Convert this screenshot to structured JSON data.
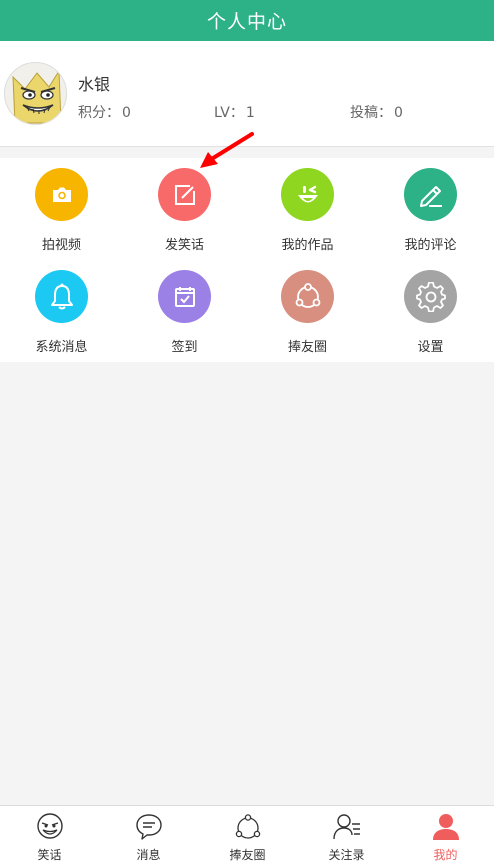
{
  "header": {
    "title": "个人中心"
  },
  "profile": {
    "name": "水银",
    "score_label": "积分：",
    "score": "0",
    "level_label": "LV：",
    "level": "1",
    "posts_label": "投稿：",
    "posts": "0"
  },
  "menu": [
    {
      "label": "拍视频",
      "color": "#f7b500",
      "icon": "camera-icon"
    },
    {
      "label": "发笑话",
      "color": "#f86a6a",
      "icon": "edit-icon"
    },
    {
      "label": "我的作品",
      "color": "#8ed61f",
      "icon": "wink-face-icon"
    },
    {
      "label": "我的评论",
      "color": "#2db186",
      "icon": "pencil-icon"
    },
    {
      "label": "系统消息",
      "color": "#1bc9f3",
      "icon": "bell-icon"
    },
    {
      "label": "签到",
      "color": "#9b80e6",
      "icon": "calendar-check-icon"
    },
    {
      "label": "捧友圈",
      "color": "#d88f7f",
      "icon": "circle-nodes-icon"
    },
    {
      "label": "设置",
      "color": "#a4a4a4",
      "icon": "gear-icon"
    }
  ],
  "tabs": [
    {
      "label": "笑话",
      "icon": "troll-face-icon",
      "active": false
    },
    {
      "label": "消息",
      "icon": "chat-bubble-icon",
      "active": false
    },
    {
      "label": "捧友圈",
      "icon": "circle-nodes-icon",
      "active": false
    },
    {
      "label": "关注录",
      "icon": "contacts-icon",
      "active": false
    },
    {
      "label": "我的",
      "icon": "person-icon",
      "active": true
    }
  ],
  "colors": {
    "brand": "#2db186",
    "active_tab": "#f05d5d",
    "annotation_arrow": "#ff0000"
  }
}
